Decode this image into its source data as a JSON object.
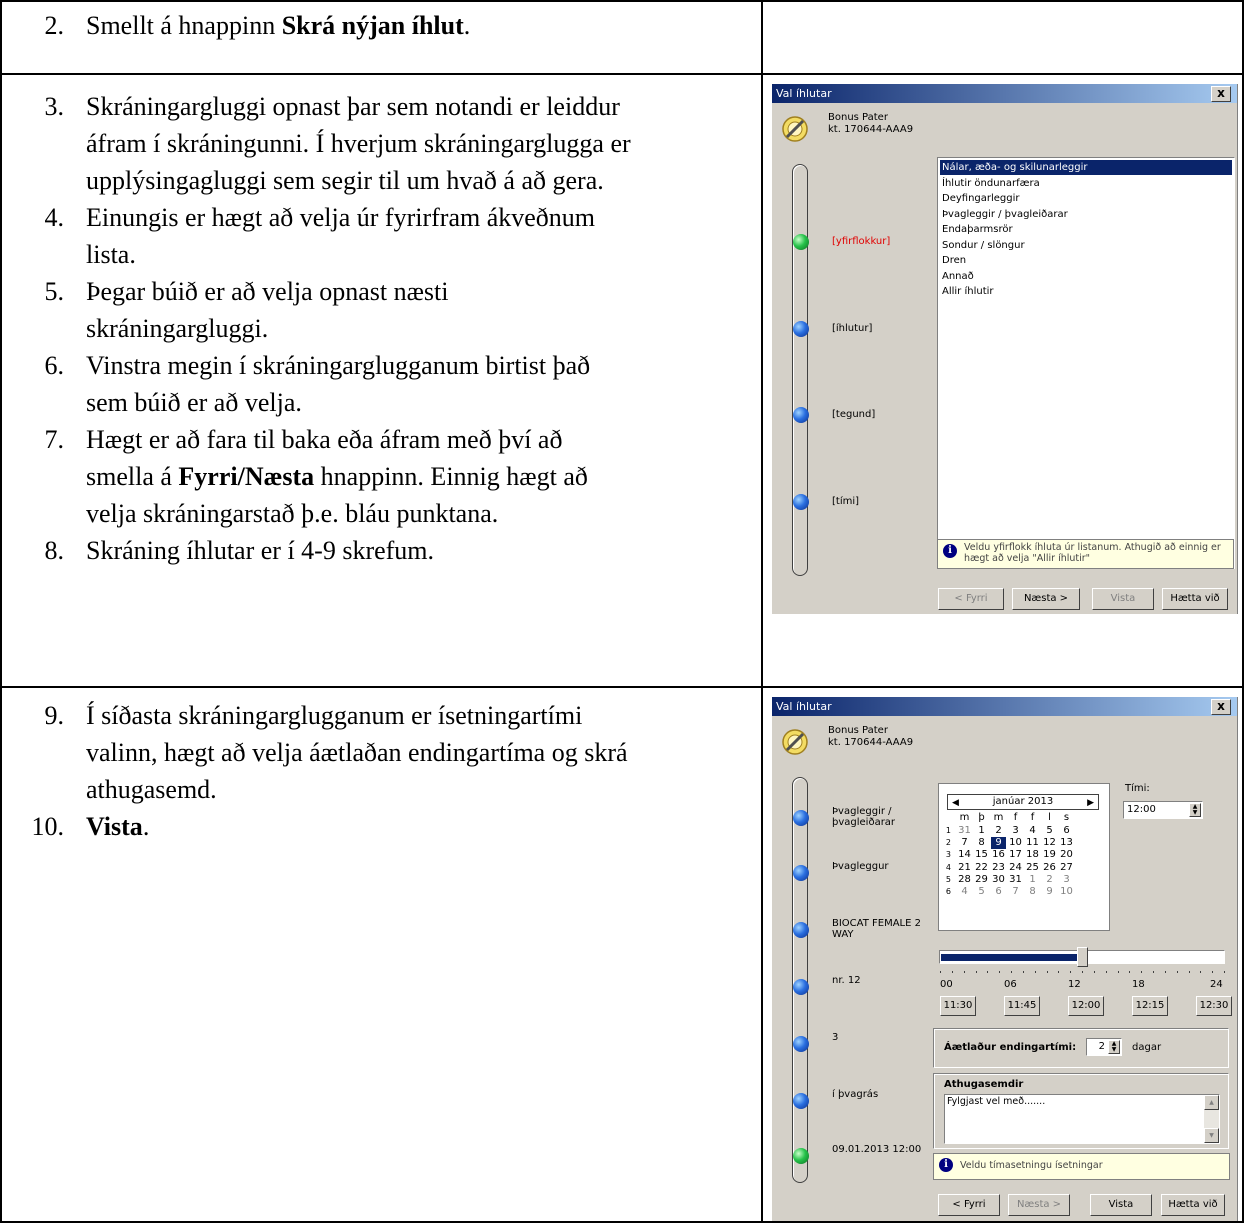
{
  "steps_top": [
    {
      "num": "2.",
      "lines": [
        [
          "Smellt á hnappinn ",
          {
            "b": "Skrá nýjan íhlut"
          },
          "."
        ]
      ]
    }
  ],
  "steps_mid": [
    {
      "num": "3.",
      "lines": [
        [
          "Skráningargluggi opnast þar sem notandi er leiddur"
        ],
        [
          "áfram í skráningunni. Í hverjum skráningarglugga er"
        ],
        [
          "upplýsingagluggi sem segir til um hvað á að gera."
        ]
      ]
    },
    {
      "num": "4.",
      "lines": [
        [
          "Einungis er hægt að velja úr fyrirfram ákveðnum"
        ],
        [
          "lista."
        ]
      ]
    },
    {
      "num": "5.",
      "lines": [
        [
          "Þegar búið er að velja opnast næsti"
        ],
        [
          "skráningargluggi."
        ]
      ]
    },
    {
      "num": "6.",
      "lines": [
        [
          "Vinstra megin í skráningarglugganum birtist það"
        ],
        [
          "sem búið er að velja."
        ]
      ]
    },
    {
      "num": "7.",
      "lines": [
        [
          "Hægt er að fara til baka eða áfram með því að"
        ],
        [
          "smella á ",
          {
            "b": "Fyrri/Næsta"
          },
          " hnappinn. Einnig hægt að"
        ],
        [
          "velja skráningarstað þ.e. bláu punktana."
        ]
      ]
    },
    {
      "num": "8.",
      "lines": [
        [
          "Skráning íhlutar er í 4-9 skrefum."
        ]
      ]
    }
  ],
  "steps_bot": [
    {
      "num": "9.",
      "lines": [
        [
          "Í síðasta skráningarglugganum er ísetningartími"
        ],
        [
          "valinn, hægt að velja áætlaðan endingartíma og skrá"
        ],
        [
          "athugasemd."
        ]
      ]
    },
    {
      "num": "10.",
      "lines": [
        [
          {
            "b": "Vista"
          },
          "."
        ]
      ]
    }
  ],
  "dialog1": {
    "title": "Val íhlutar",
    "close": "x",
    "patient_name": "Bonus Pater",
    "patient_id": "kt. 170644-AAA9",
    "steps": [
      "[yfirflokkur]",
      "[íhlutur]",
      "[tegund]",
      "[tími]"
    ],
    "list": [
      "Nálar, æða- og skilunarleggir",
      "Íhlutir öndunarfæra",
      "Deyfingarleggir",
      "Þvagleggir / þvagleiðarar",
      "Endaþarmsrör",
      "Sondur / slöngur",
      "Dren",
      "Annað",
      "Allir íhlutir"
    ],
    "hint": "Veldu yfirflokk íhluta úr listanum. Athugið að einnig er hægt að velja \"Allir íhlutir\"",
    "btn_prev": "< Fyrri",
    "btn_next": "Næsta >",
    "btn_save": "Vista",
    "btn_cancel": "Hætta við",
    "info_glyph": "i"
  },
  "dialog2": {
    "title": "Val íhlutar",
    "close": "x",
    "patient_name": "Bonus Pater",
    "patient_id": "kt. 170644-AAA9",
    "steps": [
      "Þvagleggir / þvagleiðarar",
      "Þvagleggur",
      "BIOCAT FEMALE 2 WAY",
      "nr. 12",
      "3",
      "í þvagrás",
      "09.01.2013 12:00"
    ],
    "calendar": {
      "month": "janúar 2013",
      "weekdays": [
        "m",
        "þ",
        "m",
        "f",
        "f",
        "l",
        "s"
      ],
      "weeks": [
        "1",
        "2",
        "3",
        "4",
        "5",
        "6"
      ],
      "rows": [
        [
          "31",
          "1",
          "2",
          "3",
          "4",
          "5",
          "6"
        ],
        [
          "7",
          "8",
          "9",
          "10",
          "11",
          "12",
          "13"
        ],
        [
          "14",
          "15",
          "16",
          "17",
          "18",
          "19",
          "20"
        ],
        [
          "21",
          "22",
          "23",
          "24",
          "25",
          "26",
          "27"
        ],
        [
          "28",
          "29",
          "30",
          "31",
          "1",
          "2",
          "3"
        ],
        [
          "4",
          "5",
          "6",
          "7",
          "8",
          "9",
          "10"
        ]
      ],
      "selected": "9"
    },
    "time_label": "Tími:",
    "time_value": "12:00",
    "slider_value_hours": 12,
    "axis": [
      "00",
      "06",
      "12",
      "18",
      "24"
    ],
    "quick_times": [
      "11:30",
      "11:45",
      "12:00",
      "12:15",
      "12:30"
    ],
    "end_label": "Áætlaður endingartími:",
    "end_value": "2",
    "end_unit": "dagar",
    "comments_label": "Athugasemdir",
    "comments_value": "Fylgjast vel með.......",
    "hint": "Veldu tímasetningu ísetningar",
    "btn_prev": "< Fyrri",
    "btn_next": "Næsta >",
    "btn_save": "Vista",
    "btn_cancel": "Hætta við",
    "info_glyph": "i"
  }
}
